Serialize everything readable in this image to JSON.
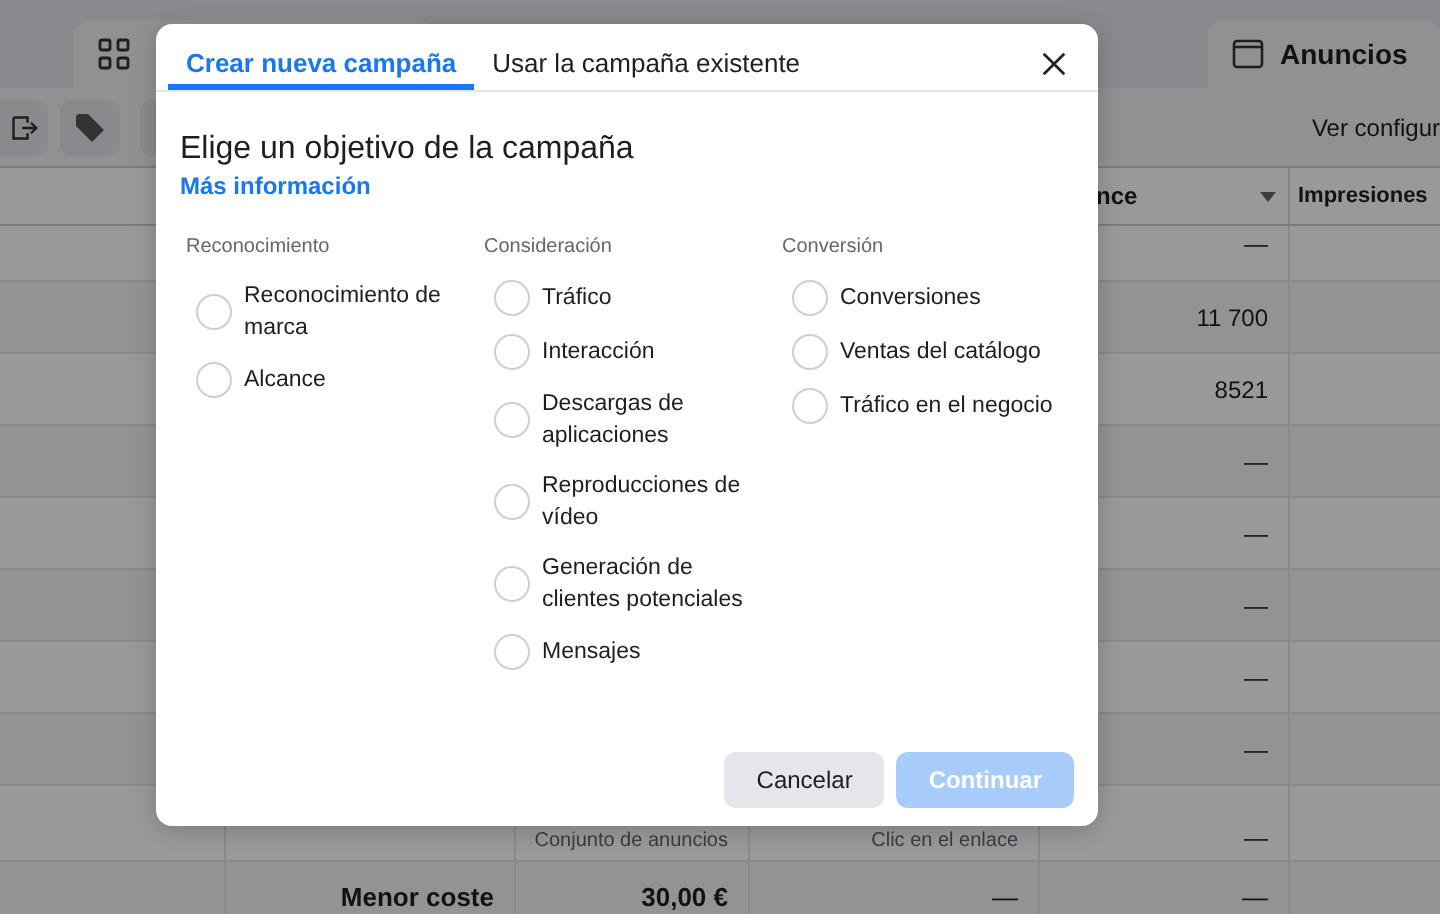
{
  "background": {
    "tabs": [
      {
        "kind": "grid"
      },
      {
        "kind": "window",
        "label": "Anuncios"
      }
    ],
    "toolbar": {
      "view_settings": "Ver configur"
    },
    "table": {
      "columns": {
        "column_5": "nce",
        "column_6": "Impresiones"
      },
      "rows": [
        {
          "column_5": "—"
        },
        {
          "column_5": "11 700"
        },
        {
          "column_5": "8521"
        },
        {
          "column_5": "—"
        },
        {
          "column_5": "—"
        },
        {
          "column_5": "—"
        },
        {
          "column_5": "—"
        },
        {
          "column_5": "—"
        },
        {
          "column_5": "—",
          "column_3_caption": "Conjunto de anuncios",
          "column_4_caption": "Clic en el enlace"
        },
        {
          "column_2": "Menor coste",
          "column_3": "30,00 €",
          "column_4": "—",
          "column_5": "—"
        }
      ]
    }
  },
  "dialog": {
    "tabs": [
      {
        "label": "Crear nueva campaña",
        "selected": true
      },
      {
        "label": "Usar la campaña existente",
        "selected": false
      }
    ],
    "title": "Elige un objetivo de la campaña",
    "link": "Más información",
    "groups": [
      {
        "label": "Reconocimiento",
        "options": [
          {
            "label": "Reconocimiento de marca",
            "selected": false
          },
          {
            "label": "Alcance",
            "selected": false
          }
        ]
      },
      {
        "label": "Consideración",
        "options": [
          {
            "label": "Tráfico",
            "selected": false
          },
          {
            "label": "Interacción",
            "selected": false
          },
          {
            "label": "Descargas de aplicaciones",
            "selected": false
          },
          {
            "label": "Reproducciones de vídeo",
            "selected": false
          },
          {
            "label": "Generación de clientes potenciales",
            "selected": false
          },
          {
            "label": "Mensajes",
            "selected": false
          }
        ]
      },
      {
        "label": "Conversión",
        "options": [
          {
            "label": "Conversiones",
            "selected": false
          },
          {
            "label": "Ventas del catálogo",
            "selected": false
          },
          {
            "label": "Tráfico en el negocio",
            "selected": false
          }
        ]
      }
    ],
    "buttons": [
      {
        "label": "Cancelar",
        "kind": "secondary",
        "disabled": false
      },
      {
        "label": "Continuar",
        "kind": "primary",
        "disabled": true
      }
    ]
  }
}
